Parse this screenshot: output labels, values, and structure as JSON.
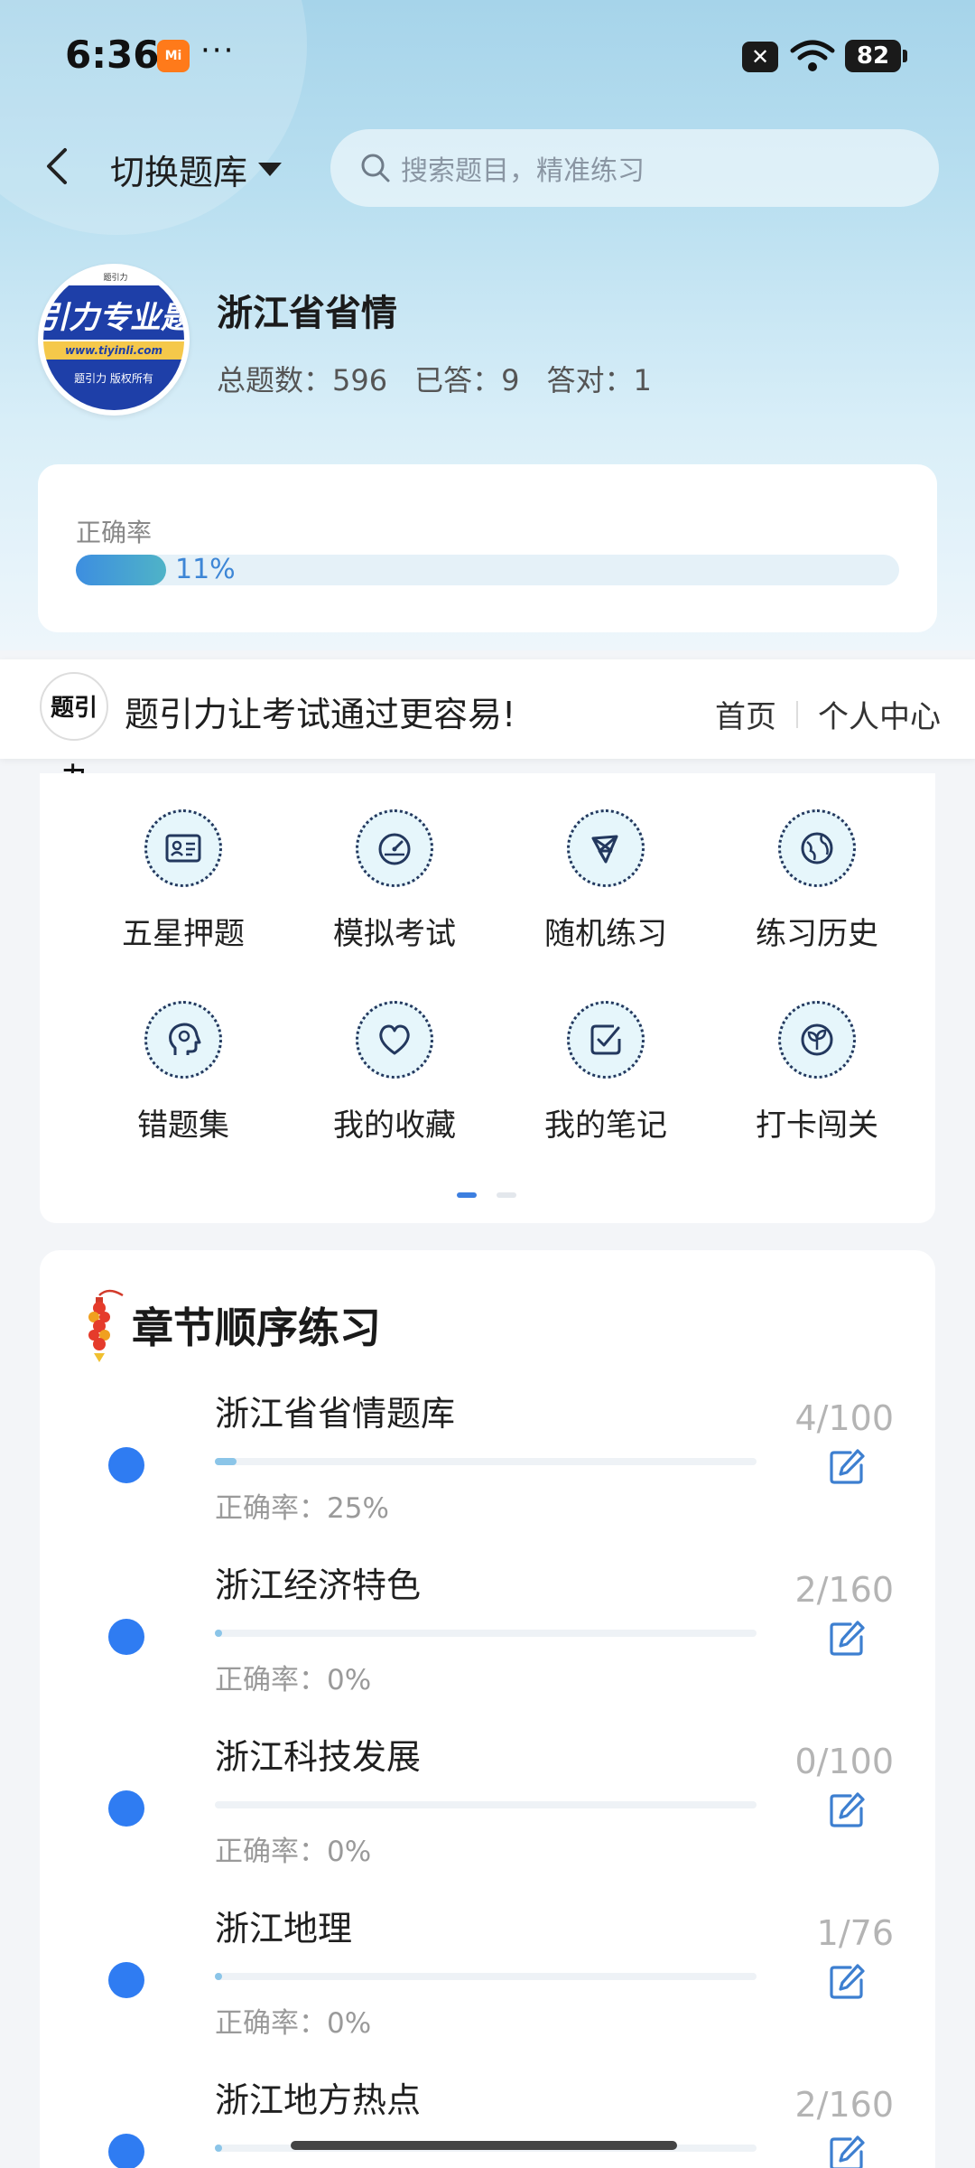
{
  "status_bar": {
    "time": "6:36",
    "app_badge": "Mi",
    "more": "···",
    "battery": "82"
  },
  "top_bar": {
    "switch_label": "切换题库",
    "search_placeholder": "搜索题目，精准练习"
  },
  "bank": {
    "logo_text": "引力专业题",
    "logo_url": "www.tiyinli.com",
    "logo_copy": "题引力 版权所有",
    "logo_mark": "题引力",
    "title": "浙江省省情",
    "total_label": "总题数：596",
    "answered_label": "已答：9",
    "correct_label": "答对：1"
  },
  "accuracy": {
    "label": "正确率",
    "value": "11%",
    "fraction": 0.11
  },
  "banner": {
    "logo": "题引力",
    "text": "题引力让考试通过更容易!",
    "nav_home": "首页",
    "nav_profile": "个人中心"
  },
  "features": [
    {
      "label": "五星押题",
      "icon": "id-card-icon"
    },
    {
      "label": "模拟考试",
      "icon": "speedometer-icon"
    },
    {
      "label": "随机练习",
      "icon": "network-icon"
    },
    {
      "label": "练习历史",
      "icon": "globe-icon"
    },
    {
      "label": "错题集",
      "icon": "head-icon"
    },
    {
      "label": "我的收藏",
      "icon": "heart-icon"
    },
    {
      "label": "我的笔记",
      "icon": "note-check-icon"
    },
    {
      "label": "打卡闯关",
      "icon": "sprout-icon"
    }
  ],
  "chapters": {
    "title": "章节顺序练习",
    "items": [
      {
        "name": "浙江省省情题库",
        "accuracy": "正确率：25%",
        "count": "4/100",
        "progress": 0.04
      },
      {
        "name": "浙江经济特色",
        "accuracy": "正确率：0%",
        "count": "2/160",
        "progress": 0.0125
      },
      {
        "name": "浙江科技发展",
        "accuracy": "正确率：0%",
        "count": "0/100",
        "progress": 0
      },
      {
        "name": "浙江地理",
        "accuracy": "正确率：0%",
        "count": "1/76",
        "progress": 0.013
      },
      {
        "name": "浙江地方热点",
        "accuracy": "",
        "count": "2/160",
        "progress": 0.0125
      }
    ]
  }
}
